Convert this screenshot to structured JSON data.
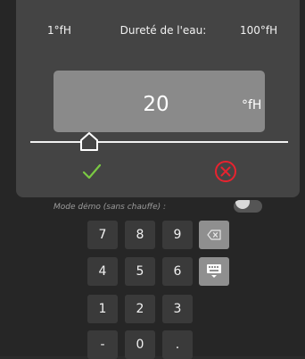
{
  "dialog": {
    "range_min": "1°fH",
    "title": "Dureté de l'eau:",
    "range_max": "100°fH",
    "value": "20",
    "unit": "°fH",
    "slider_value": 20,
    "slider_min": 1,
    "slider_max": 100,
    "confirm_icon": "checkmark-icon",
    "cancel_icon": "close-circle-icon",
    "accent_confirm": "#7ac943",
    "accent_cancel": "#e8232f"
  },
  "background": {
    "demo_mode_label": "Mode démo (sans chauffe) :"
  },
  "keypad": {
    "k7": "7",
    "k8": "8",
    "k9": "9",
    "k4": "4",
    "k5": "5",
    "k6": "6",
    "k1": "1",
    "k2": "2",
    "k3": "3",
    "minus": "-",
    "k0": "0",
    "dot": ".",
    "backspace_icon": "backspace-icon",
    "keyboard_icon": "keyboard-icon"
  }
}
